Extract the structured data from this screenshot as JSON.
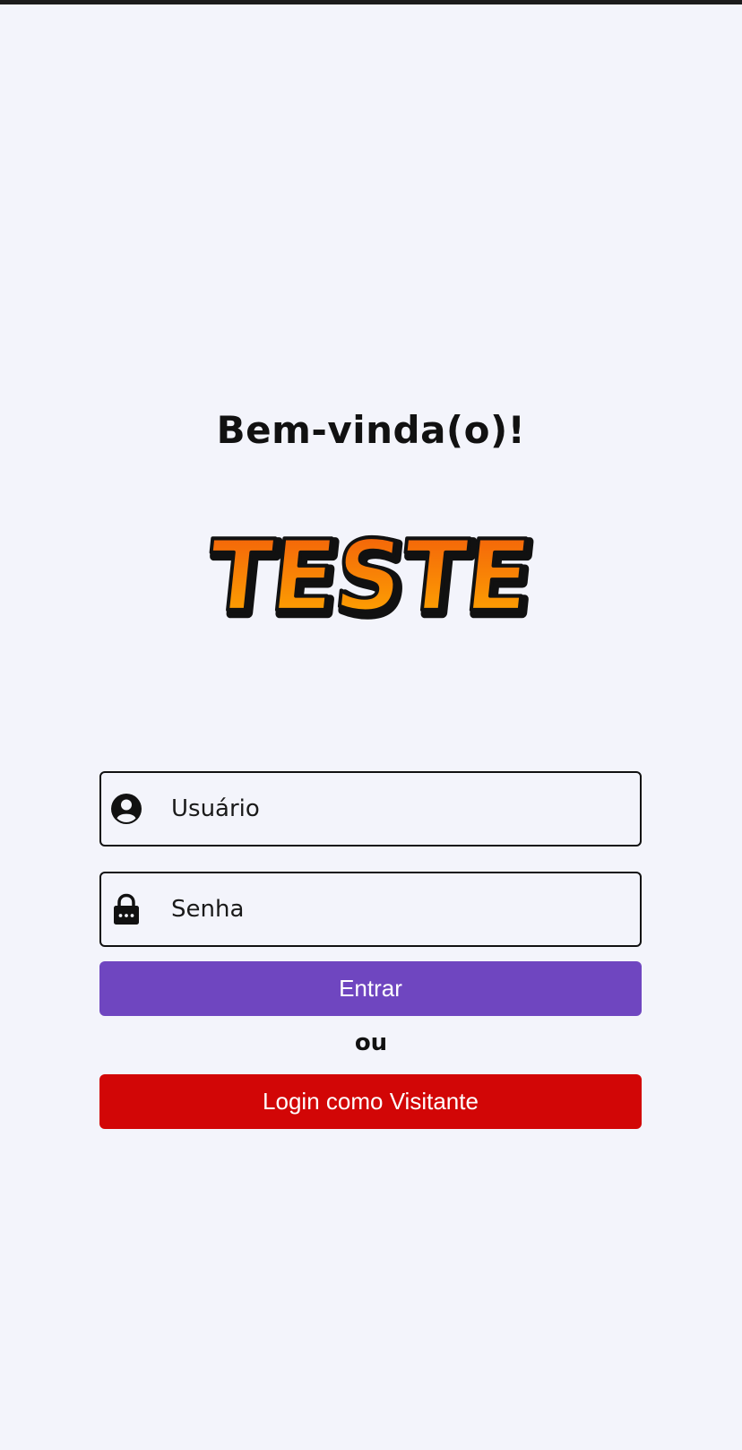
{
  "welcome_title": "Bem-vinda(o)!",
  "logo": {
    "text": "TESTE",
    "icon": "teste-logo"
  },
  "form": {
    "username": {
      "placeholder": "Usuário",
      "value": "",
      "icon": "person-icon"
    },
    "password": {
      "placeholder": "Senha",
      "value": "",
      "icon": "lock-icon"
    }
  },
  "buttons": {
    "enter_label": "Entrar",
    "or_label": "ou",
    "guest_label": "Login como Visitante"
  },
  "colors": {
    "background": "#f3f4fb",
    "enter_button": "#6f46c0",
    "guest_button": "#d20606",
    "logo_top": "#f25a0b",
    "logo_bottom": "#ffae00"
  }
}
